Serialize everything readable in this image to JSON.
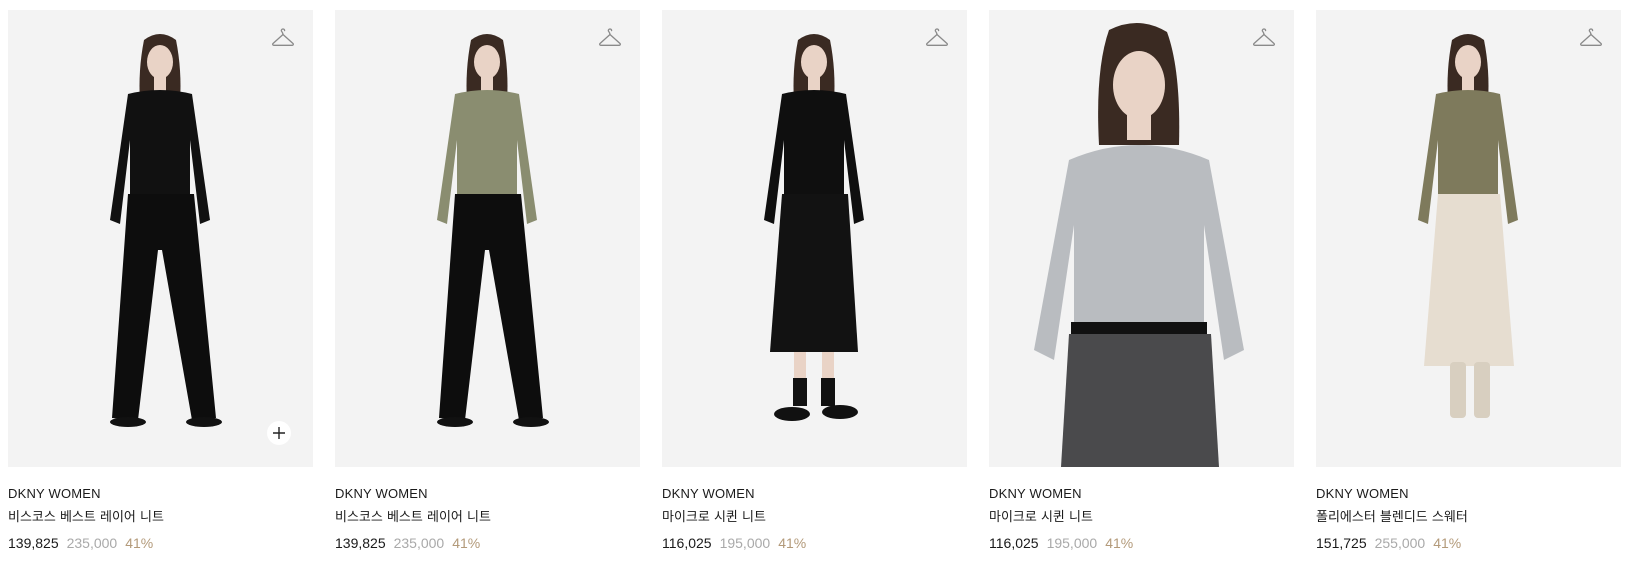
{
  "products": [
    {
      "brand": "DKNY WOMEN",
      "name": "비스코스 베스트 레이어 니트",
      "price": "139,825",
      "original_price": "235,000",
      "discount": "41%",
      "top_color": "#111111",
      "bottom_color": "#0d0d0d",
      "bottom_type": "pants",
      "shoe_color": "#111111",
      "show_plus": true
    },
    {
      "brand": "DKNY WOMEN",
      "name": "비스코스 베스트 레이어 니트",
      "price": "139,825",
      "original_price": "235,000",
      "discount": "41%",
      "top_color": "#8a8d70",
      "bottom_color": "#0d0d0d",
      "bottom_type": "pants",
      "shoe_color": "#111111",
      "show_plus": false
    },
    {
      "brand": "DKNY WOMEN",
      "name": "마이크로 시퀸 니트",
      "price": "116,025",
      "original_price": "195,000",
      "discount": "41%",
      "top_color": "#0f0f0f",
      "bottom_color": "#121212",
      "bottom_type": "skirt",
      "shoe_color": "#111111",
      "show_plus": false
    },
    {
      "brand": "DKNY WOMEN",
      "name": "마이크로 시퀸 니트",
      "price": "116,025",
      "original_price": "195,000",
      "discount": "41%",
      "top_color": "#b9bcc0",
      "bottom_color": "#4a4a4c",
      "bottom_type": "closeup",
      "shoe_color": "#111111",
      "show_plus": false
    },
    {
      "brand": "DKNY WOMEN",
      "name": "폴리에스터 블렌디드 스웨터",
      "price": "151,725",
      "original_price": "255,000",
      "discount": "41%",
      "top_color": "#7e7a5c",
      "bottom_color": "#e6ddd0",
      "bottom_type": "longskirt",
      "shoe_color": "#d8cfc0",
      "show_plus": false
    }
  ],
  "icons": {
    "wishlist": "hanger-icon",
    "quick_add": "plus-icon"
  },
  "colors": {
    "card_bg": "#f3f3f3",
    "original_price": "#a9a9a9",
    "discount": "#b39a7a"
  }
}
